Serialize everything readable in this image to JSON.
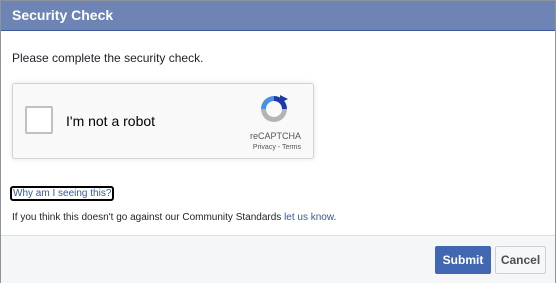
{
  "dialog": {
    "title": "Security Check",
    "instructions": "Please complete the security check."
  },
  "captcha": {
    "checkbox_label": "I'm not a robot",
    "checked": false,
    "brand": "reCAPTCHA",
    "privacy_label": "Privacy",
    "separator": " - ",
    "terms_label": "Terms",
    "logo_icon": "recaptcha-logo-icon",
    "colors": {
      "blue": "#1c3aa9",
      "light_blue": "#4a90e2",
      "gray": "#b4b4b4"
    }
  },
  "help": {
    "why_link": "Why am I seeing this?",
    "community_text": "If you think this doesn't go against our Community Standards ",
    "community_link": "let us know",
    "community_end": "."
  },
  "footer": {
    "submit_label": "Submit",
    "cancel_label": "Cancel"
  },
  "colors": {
    "titlebar": "#6d84b4",
    "primary_button": "#4267b2",
    "link": "#365899"
  }
}
